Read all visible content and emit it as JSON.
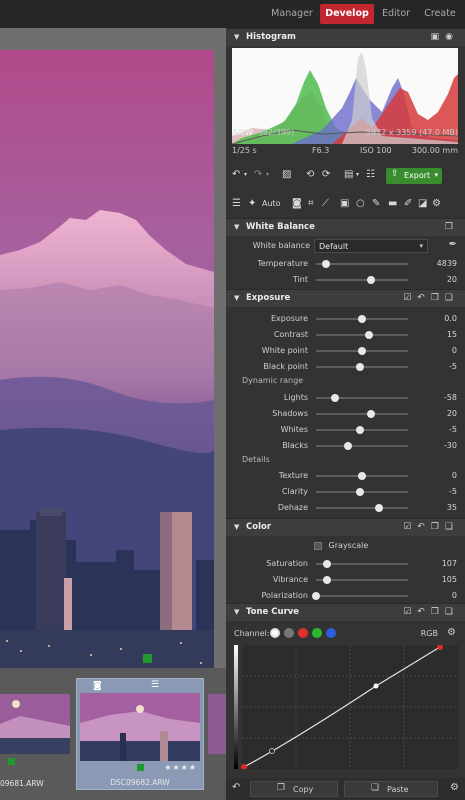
{
  "nav": {
    "tabs": [
      {
        "label": "Manager"
      },
      {
        "label": "Develop"
      },
      {
        "label": "Editor"
      },
      {
        "label": "Create"
      }
    ],
    "active": "Develop",
    "accent": "#c2262e"
  },
  "filmstrip": {
    "items": [
      {
        "name": "09681.ARW",
        "selected": false,
        "stars": ""
      },
      {
        "name": "DSC09682.ARW",
        "selected": true,
        "stars": "★★★★"
      }
    ]
  },
  "histogram": {
    "title": "Histogram",
    "format": "ARW",
    "counter": "(82/399)",
    "dimensions": "5972 x 3359 (47.0 MB)",
    "shutter": "1/25 s",
    "aperture": "F6.3",
    "iso": "ISO 100",
    "focal": "300.00 mm"
  },
  "toolbar": {
    "export_label": "Export",
    "export_color": "#3a8d2e",
    "auto_label": "Auto"
  },
  "white_balance": {
    "title": "White Balance",
    "select_label": "White balance",
    "select_value": "Default",
    "sliders": [
      {
        "label": "Temperature",
        "value": "4839",
        "pos": 0.11
      },
      {
        "label": "Tint",
        "value": "20",
        "pos": 0.6
      }
    ]
  },
  "exposure": {
    "title": "Exposure",
    "sliders": [
      {
        "label": "Exposure",
        "value": "0.0",
        "pos": 0.5
      },
      {
        "label": "Contrast",
        "value": "15",
        "pos": 0.58
      },
      {
        "label": "White point",
        "value": "0",
        "pos": 0.5
      },
      {
        "label": "Black point",
        "value": "-5",
        "pos": 0.48
      }
    ],
    "dynamic_range_label": "Dynamic range",
    "dynamic_range": [
      {
        "label": "Lights",
        "value": "-58",
        "pos": 0.21
      },
      {
        "label": "Shadows",
        "value": "20",
        "pos": 0.6
      },
      {
        "label": "Whites",
        "value": "-5",
        "pos": 0.48
      },
      {
        "label": "Blacks",
        "value": "-30",
        "pos": 0.35
      }
    ],
    "details_label": "Details",
    "details": [
      {
        "label": "Texture",
        "value": "0",
        "pos": 0.5
      },
      {
        "label": "Clarity",
        "value": "-5",
        "pos": 0.48
      },
      {
        "label": "Dehaze",
        "value": "35",
        "pos": 0.68
      }
    ]
  },
  "color": {
    "title": "Color",
    "grayscale_label": "Grayscale",
    "sliders": [
      {
        "label": "Saturation",
        "value": "107",
        "pos": 0.12
      },
      {
        "label": "Vibrance",
        "value": "105",
        "pos": 0.12
      },
      {
        "label": "Polarization",
        "value": "0",
        "pos": 0.0
      }
    ]
  },
  "tone_curve": {
    "title": "Tone Curve",
    "channel_label": "Channel:",
    "mode": "RGB"
  },
  "bottom": {
    "copy_label": "Copy",
    "paste_label": "Paste"
  }
}
